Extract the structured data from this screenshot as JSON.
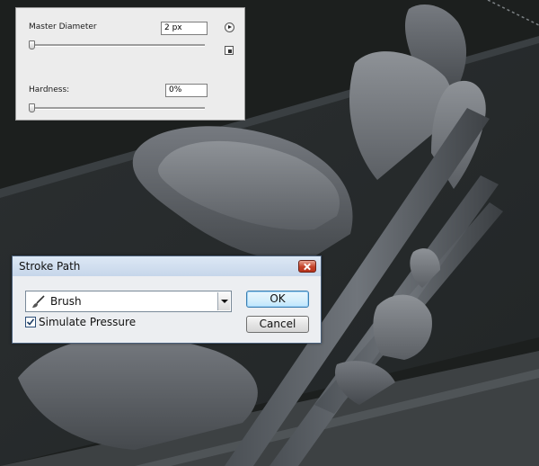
{
  "brush_panel": {
    "master_diameter_label": "Master Diameter",
    "master_diameter_value": "2 px",
    "hardness_label": "Hardness:",
    "hardness_value": "0%"
  },
  "stroke_path_dialog": {
    "title": "Stroke Path",
    "tool_selected": "Brush",
    "simulate_pressure_label": "Simulate Pressure",
    "simulate_pressure_checked": true,
    "ok_label": "OK",
    "cancel_label": "Cancel"
  }
}
